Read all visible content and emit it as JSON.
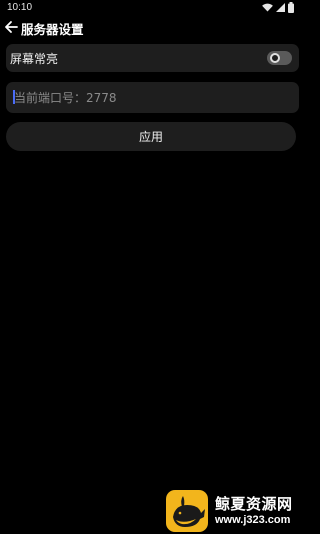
{
  "status_bar": {
    "time": "10:10",
    "icons": [
      "wifi-icon",
      "signal-icon",
      "battery-icon"
    ]
  },
  "app_bar": {
    "back_icon": "arrow-left-icon",
    "title": "服务器设置"
  },
  "settings": {
    "screen_on": {
      "label": "屏幕常亮",
      "enabled": false
    },
    "port": {
      "value": "",
      "placeholder": "当前端口号：2778"
    }
  },
  "actions": {
    "apply_label": "应用"
  },
  "watermark": {
    "name": "鲸夏资源网",
    "url": "www.j323.com"
  },
  "colors": {
    "background": "#000000",
    "surface": "#1e1e1e",
    "toggle_track": "#5a5a5a",
    "caret": "#4a6cf7",
    "logo": "#f2b51c"
  }
}
